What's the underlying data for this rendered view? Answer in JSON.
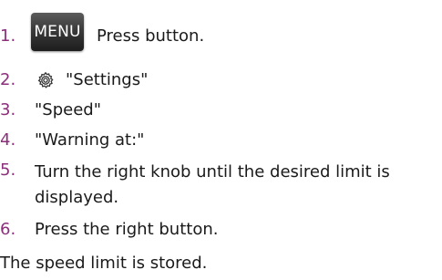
{
  "steps": [
    {
      "number": "1.",
      "button_label": "MENU",
      "text": "Press button."
    },
    {
      "number": "2.",
      "icon": "gear-icon",
      "text": "\"Settings\""
    },
    {
      "number": "3.",
      "text": "\"Speed\""
    },
    {
      "number": "4.",
      "text": "\"Warning at:\""
    },
    {
      "number": "5.",
      "text": "Turn the right knob until the desired limit is displayed."
    },
    {
      "number": "6.",
      "text": "Press the right button."
    }
  ],
  "result": "The speed limit is stored.",
  "colors": {
    "step_number": "#8b2f7a",
    "text": "#1a1a1a",
    "menu_button": "#2a2a2a"
  }
}
